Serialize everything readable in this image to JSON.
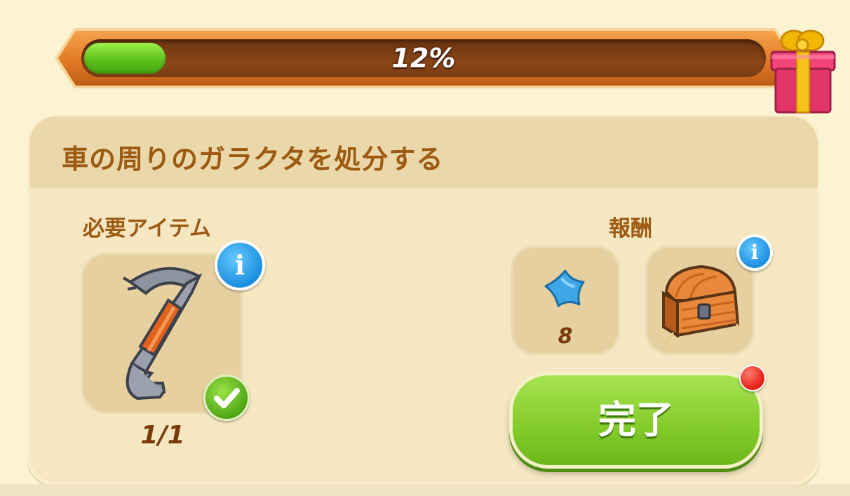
{
  "progress": {
    "fraction": 0.12,
    "label": "12%"
  },
  "task": {
    "title": "車の周りのガラクタを処分する",
    "required": {
      "label": "必要アイテム",
      "item_icon": "crowbar-icon",
      "count": "1/1"
    },
    "reward": {
      "label": "報酬",
      "items": [
        {
          "icon": "blue-star-icon",
          "amount": "8"
        },
        {
          "icon": "treasure-chest-icon",
          "amount": ""
        }
      ]
    },
    "complete_button_label": "完了"
  },
  "colors": {
    "accent_green": "#86cc2c",
    "title_brown": "#9c5a12",
    "info_blue": "#1d8fe0",
    "notify_red": "#e51d13"
  }
}
